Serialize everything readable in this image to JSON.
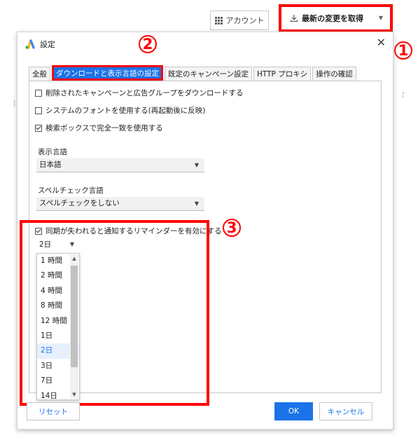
{
  "toolbar": {
    "account_label": "アカウント",
    "get_changes_label": "最新の変更を取得",
    "account_icon": "grid-icon",
    "download_icon": "download-icon"
  },
  "annotations": {
    "marker1": "1",
    "marker2": "2",
    "marker3": "3",
    "marker_color": "#ff0000"
  },
  "dialog": {
    "title": "設定",
    "tabs": [
      {
        "label": "全般"
      },
      {
        "label": "ダウンロードと表示言語の設定",
        "active": true
      },
      {
        "label": "既定のキャンペーン設定"
      },
      {
        "label": "HTTP プロキシ"
      },
      {
        "label": "操作の確認"
      }
    ],
    "checkboxes": [
      {
        "label": "削除されたキャンペーンと広告グループをダウンロードする",
        "checked": false
      },
      {
        "label": "システムのフォントを使用する(再起動後に反映)",
        "checked": false
      },
      {
        "label": "検索ボックスで完全一致を使用する",
        "checked": true
      }
    ],
    "display_language": {
      "label": "表示言語",
      "value": "日本語"
    },
    "spellcheck_language": {
      "label": "スペルチェック言語",
      "value": "スペルチェックをしない"
    },
    "reminder": {
      "label": "同期が失われると通知するリマインダーを有効にする",
      "checked": true,
      "selected": "2日",
      "options": [
        "1 時間",
        "2 時間",
        "4 時間",
        "8 時間",
        "12 時間",
        "1日",
        "2日",
        "3日",
        "7日",
        "14日"
      ]
    },
    "buttons": {
      "reset": "リセット",
      "ok": "OK",
      "cancel": "キャンセル"
    },
    "accent_color": "#1a73e8"
  }
}
